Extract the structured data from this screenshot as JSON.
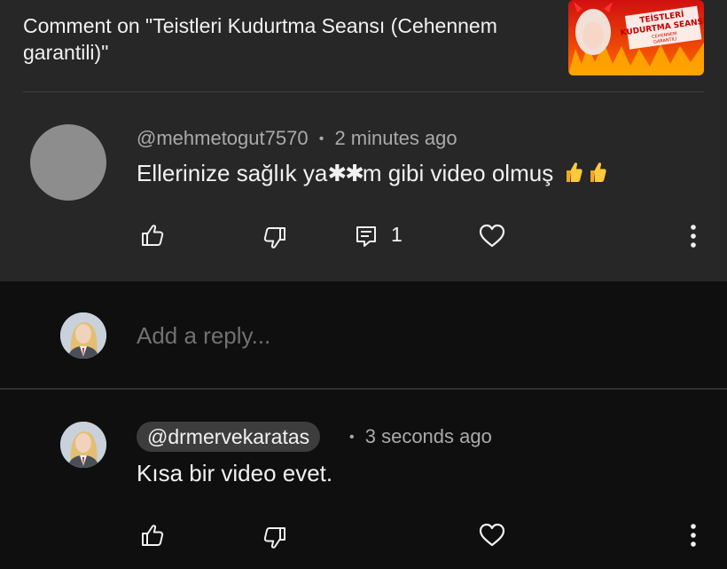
{
  "header": {
    "title": "Comment on \"Teistleri Kudurtma Seansı (Cehennem garantili)\"",
    "thumbnail": {
      "line1": "TEİSTLERİ",
      "line2": "KUDURTMA SEANSI",
      "line3": "CEHENNEM",
      "line4": "GARANTİLİ"
    }
  },
  "comment": {
    "author": "@mehmetogut7570",
    "separator": "•",
    "time": "2 minutes ago",
    "text_before": "Ellerinize sağlık ya",
    "text_censored": "✱✱",
    "text_after": "m gibi video olmuş",
    "reply_count": "1"
  },
  "reply_box": {
    "placeholder": "Add a reply..."
  },
  "reply": {
    "author": "@drmervekaratas",
    "separator": "•",
    "time": "3 seconds ago",
    "text": "Kısa bir video evet."
  },
  "icons": {
    "like": "thumbs-up-icon",
    "dislike": "thumbs-down-icon",
    "reply": "comment-icon",
    "heart": "heart-icon",
    "more": "more-vert-icon"
  },
  "colors": {
    "background": "#0f0f0f",
    "card": "#272727",
    "text": "#f1f1f1",
    "muted": "#aaaaaa",
    "chip": "#3d3d3d"
  }
}
